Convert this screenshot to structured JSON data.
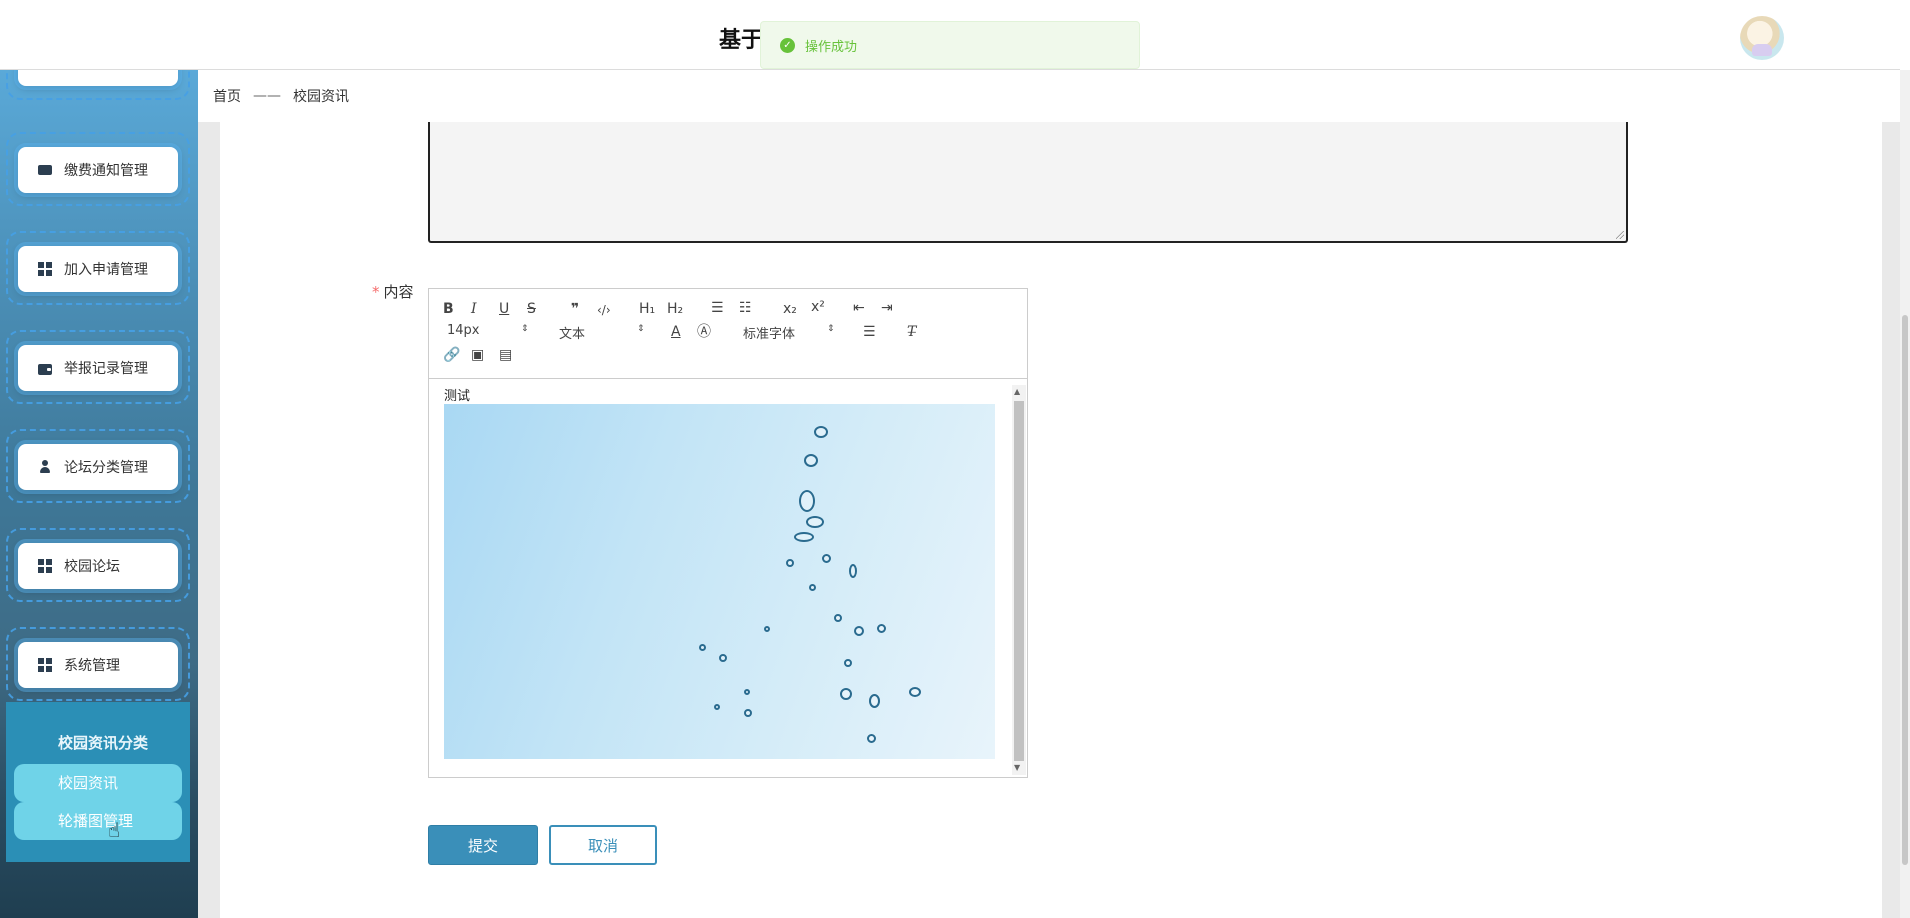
{
  "header": {
    "title": "基于"
  },
  "toast": {
    "message": "操作成功",
    "color": "#67c23a"
  },
  "breadcrumb": {
    "home": "首页",
    "separator": "——",
    "current": "校园资讯"
  },
  "sidebar": {
    "menu": [
      {
        "label": "缴费通知管理",
        "icon": "ticket-icon"
      },
      {
        "label": "加入申请管理",
        "icon": "grid-icon"
      },
      {
        "label": "举报记录管理",
        "icon": "wallet-icon"
      },
      {
        "label": "论坛分类管理",
        "icon": "user-icon"
      },
      {
        "label": "校园论坛",
        "icon": "grid-icon"
      },
      {
        "label": "系统管理",
        "icon": "grid-icon"
      }
    ],
    "submenu": {
      "heading": "校园资讯分类",
      "items": [
        "校园资讯",
        "轮播图管理"
      ]
    }
  },
  "form": {
    "content_label": "内容",
    "required_mark": "*",
    "editor": {
      "font_size": "14px",
      "block_format": "文本",
      "font_family": "标准字体",
      "body_text": "测试"
    },
    "submit_label": "提交",
    "cancel_label": "取消"
  },
  "colors": {
    "accent": "#3a8fb9",
    "submenu_bg": "#2b8fb6",
    "submenu_item": "#6fd3e8"
  }
}
